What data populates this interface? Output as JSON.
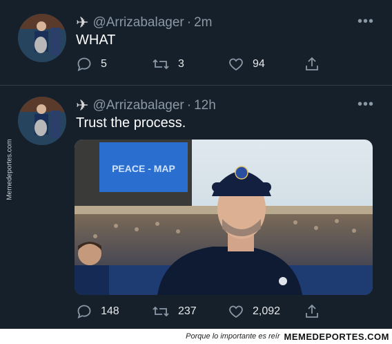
{
  "tweets": [
    {
      "handle": "@Arrizabalager",
      "time": "2m",
      "text": "WHAT",
      "replies": "5",
      "retweets": "3",
      "likes": "94"
    },
    {
      "handle": "@Arrizabalager",
      "time": "12h",
      "text": "Trust the process.",
      "replies": "148",
      "retweets": "237",
      "likes": "2,092",
      "photo_banner": "PEACE - MAP"
    }
  ],
  "separator": "·",
  "more_glyph": "•••",
  "watermark": "Memedeportes.com",
  "footer": {
    "tagline": "Porque lo importante es reír",
    "brand": "MEMEDEPORTES.COM"
  },
  "colors": {
    "background": "#15202b",
    "muted": "#8b98a5",
    "text": "#ffffff"
  }
}
